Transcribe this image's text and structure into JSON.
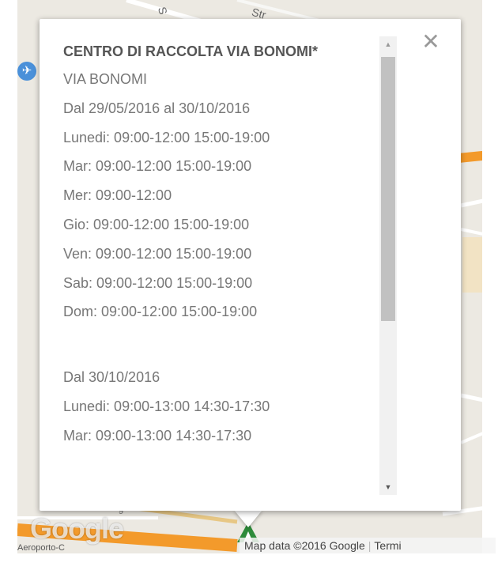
{
  "map": {
    "street_label_1": "Str",
    "street_label_2": "S",
    "airport_label": "Aeroporto-C",
    "google_logo": "Google",
    "attribution": "Map data ©2016 Google",
    "terms": "Termi",
    "colors": {
      "road_orange": "#f39a2b",
      "land": "#ece9e2",
      "marker_green": "#2e8b3a"
    }
  },
  "icons": {
    "airport": "airplane-icon",
    "close": "close-icon",
    "marker": "map-marker-icon"
  },
  "info_window": {
    "title": "CENTRO DI RACCOLTA VIA BONOMI*",
    "close_glyph": "✕",
    "lines": [
      "VIA BONOMI",
      "Dal 29/05/2016 al 30/10/2016",
      "Lunedi: 09:00-12:00 15:00-19:00",
      "Mar: 09:00-12:00 15:00-19:00",
      "Mer: 09:00-12:00",
      "Gio: 09:00-12:00 15:00-19:00",
      "Ven: 09:00-12:00 15:00-19:00",
      "Sab: 09:00-12:00 15:00-19:00",
      "Dom: 09:00-12:00 15:00-19:00",
      "",
      "Dal 30/10/2016",
      "Lunedi: 09:00-13:00 14:30-17:30",
      "Mar: 09:00-13:00 14:30-17:30"
    ]
  }
}
